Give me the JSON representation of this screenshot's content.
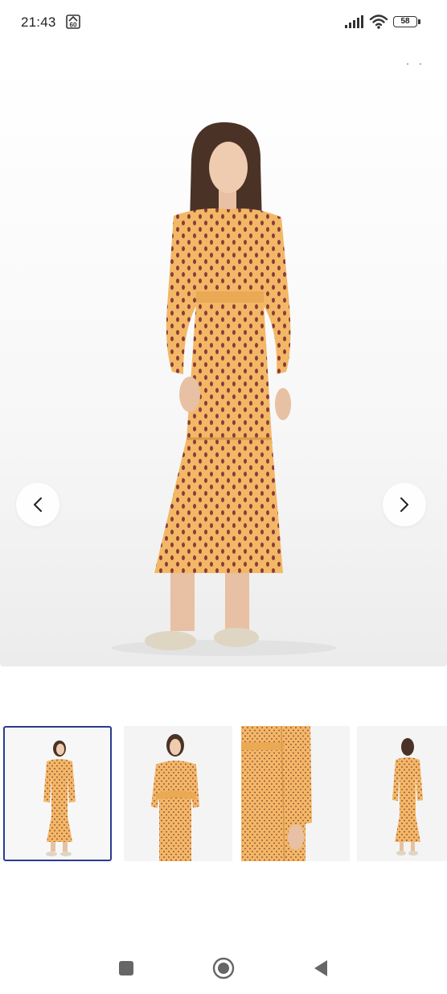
{
  "status_bar": {
    "time": "21:43",
    "badge_text": "60",
    "battery_level": "58",
    "icons": [
      "signal-icon",
      "wifi-icon",
      "battery-icon"
    ]
  },
  "gallery": {
    "close_icon": "close-icon",
    "prev_icon": "chevron-left-icon",
    "next_icon": "chevron-right-icon",
    "images": [
      {
        "view": "front-full",
        "selected": true
      },
      {
        "view": "front-arms-crossed",
        "selected": false
      },
      {
        "view": "detail-waist-sleeve",
        "selected": false
      },
      {
        "view": "back-full",
        "selected": false
      }
    ],
    "colors": {
      "dress": "#F2B866",
      "dots": "#8B3A3A",
      "selected_border": "#2B3A8F"
    }
  },
  "nav_bar": {
    "icons": [
      "recent-apps-icon",
      "home-icon",
      "back-icon"
    ]
  }
}
